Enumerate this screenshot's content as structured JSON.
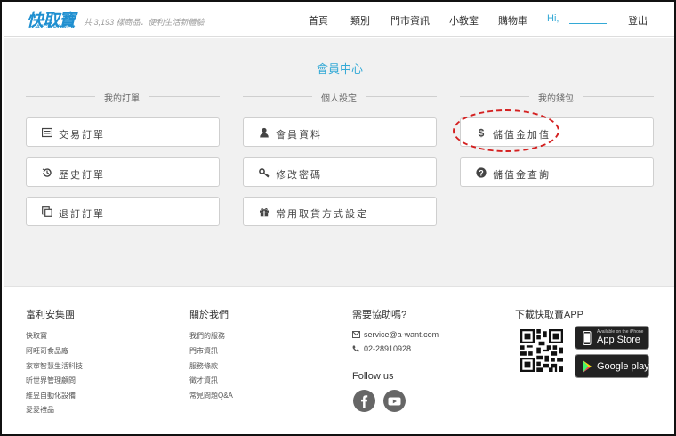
{
  "header": {
    "logo_text": "快取寶",
    "logo_sub": "CATCH POWER",
    "tagline": "共 3,193 樣商品．便利生活新體驗",
    "nav": [
      "首頁",
      "類別",
      "門市資訊",
      "小教室",
      "購物車"
    ],
    "greeting": "Hi,",
    "logout": "登出"
  },
  "member": {
    "title": "會員中心",
    "columns": [
      {
        "label": "我的訂單",
        "buttons": [
          {
            "label": "交易訂單",
            "icon": "list-icon"
          },
          {
            "label": "歷史訂單",
            "icon": "history-icon"
          },
          {
            "label": "退訂訂單",
            "icon": "copy-icon"
          }
        ]
      },
      {
        "label": "個人設定",
        "buttons": [
          {
            "label": "會員資料",
            "icon": "user-icon"
          },
          {
            "label": "修改密碼",
            "icon": "key-icon"
          },
          {
            "label": "常用取貨方式設定",
            "icon": "gift-icon"
          }
        ]
      },
      {
        "label": "我的錢包",
        "buttons": [
          {
            "label": "儲值金加值",
            "icon": "dollar-icon"
          },
          {
            "label": "儲值金查詢",
            "icon": "question-icon"
          }
        ]
      }
    ],
    "highlight_color": "#d42020"
  },
  "footer": {
    "group": {
      "title": "富利安集團",
      "links": [
        "快取寶",
        "阿旺哥食品廠",
        "家寧智慧生活科技",
        "昕世界管理顧問",
        "維昱自動化設備",
        "愛愛禮品"
      ]
    },
    "about": {
      "title": "關於我們",
      "links": [
        "我們的服務",
        "門市資訊",
        "服務條款",
        "徵才資訊",
        "常見問題Q&A"
      ]
    },
    "help": {
      "title": "需要協助嗎?",
      "email": "service@a-want.com",
      "phone": "02-28910928",
      "follow": "Follow us"
    },
    "app": {
      "title": "下載快取寶APP",
      "appstore_small": "Available on the iPhone",
      "appstore": "App Store",
      "googleplay": "Google play"
    }
  },
  "colors": {
    "accent": "#33a9d6",
    "brand": "#1f8fd0"
  }
}
